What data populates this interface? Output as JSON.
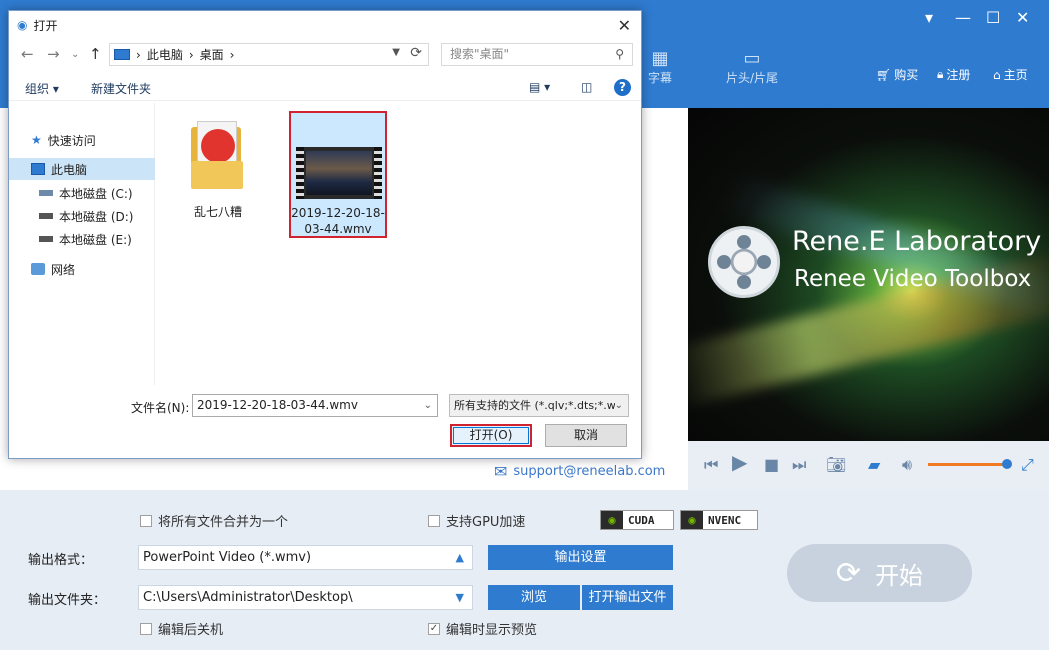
{
  "app": {
    "nav": {
      "buy": "购买",
      "register": "注册",
      "home": "主页"
    },
    "tabs": {
      "subtitle": "字幕",
      "head_tail": "片头/片尾"
    },
    "support_email": "support@reneelab.com",
    "brand": {
      "line1": "Rene.E Laboratory",
      "line2": "Renee Video Toolbox"
    },
    "options": {
      "merge_all": "将所有文件合并为一个",
      "gpu_accel": "支持GPU加速",
      "cuda": "CUDA",
      "nvenc": "NVENC",
      "shutdown_after": "编辑后关机",
      "show_preview": "编辑时显示预览",
      "show_preview_checked": true
    },
    "output_format_label": "输出格式：",
    "output_format_value": "PowerPoint Video (*.wmv)",
    "output_settings_btn": "输出设置",
    "output_folder_label": "输出文件夹：",
    "output_folder_value": "C:\\Users\\Administrator\\Desktop\\",
    "browse_btn": "浏览",
    "open_output_btn": "打开输出文件",
    "start_btn": "开始"
  },
  "dialog": {
    "title": "打开",
    "breadcrumb": [
      "此电脑",
      "桌面"
    ],
    "search_placeholder": "搜索\"桌面\"",
    "organize": "组织",
    "new_folder": "新建文件夹",
    "nav_items": [
      {
        "label": "快速访问",
        "icon": "star-icon"
      },
      {
        "label": "此电脑",
        "icon": "computer-icon",
        "selected": true
      },
      {
        "label": "本地磁盘 (C:)",
        "icon": "drive-icon"
      },
      {
        "label": "本地磁盘 (D:)",
        "icon": "drive-icon"
      },
      {
        "label": "本地磁盘 (E:)",
        "icon": "drive-icon"
      },
      {
        "label": "网络",
        "icon": "network-icon"
      }
    ],
    "files": [
      {
        "name": "乱七八糟",
        "type": "folder"
      },
      {
        "name": "2019-12-20-18-03-44.wmv",
        "name_line1": "2019-12-20-18-",
        "name_line2": "03-44.wmv",
        "type": "video",
        "selected": true
      }
    ],
    "filename_label": "文件名(N):",
    "filename_value": "2019-12-20-18-03-44.wmv",
    "filetype_value": "所有支持的文件 (*.qlv;*.dts;*.w",
    "open_btn": "打开(O)",
    "cancel_btn": "取消"
  },
  "colors": {
    "accent": "#2f7bd0",
    "highlight": "#d0232f",
    "selection": "#cce8ff"
  }
}
